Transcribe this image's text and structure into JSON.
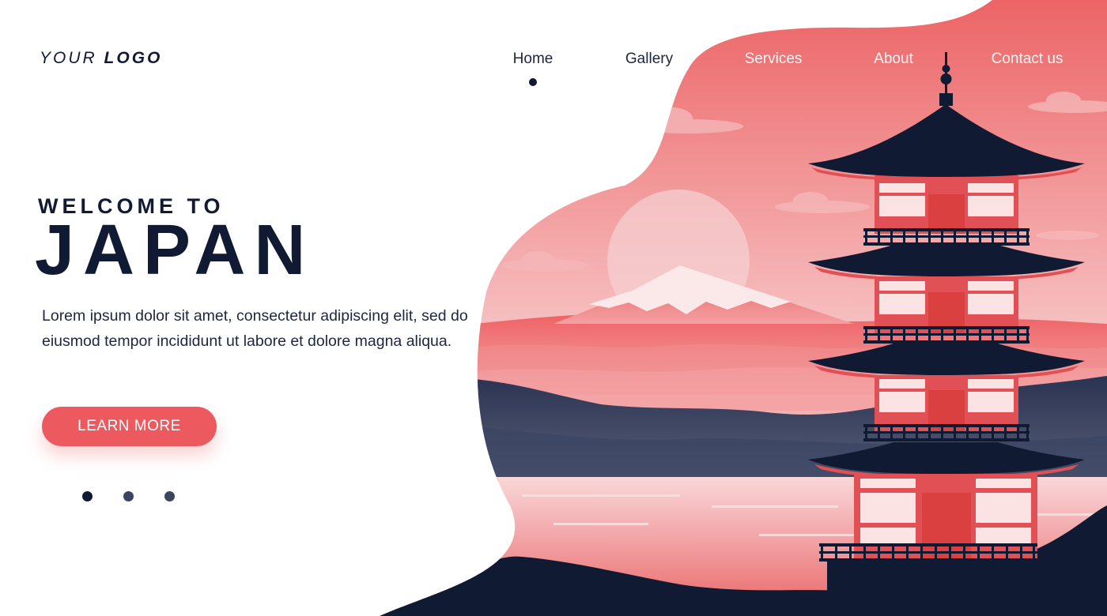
{
  "logo": {
    "part1": "YOUR",
    "part2": "LOGO"
  },
  "nav": {
    "items": [
      {
        "label": "Home",
        "active": true
      },
      {
        "label": "Gallery"
      },
      {
        "label": "Services"
      },
      {
        "label": "About"
      },
      {
        "label": "Contact us"
      }
    ]
  },
  "hero": {
    "eyebrow": "WELCOME TO",
    "title": "JAPAN",
    "description": "Lorem ipsum dolor sit amet, consectetur adipiscing elit, sed do eiusmod tempor incididunt ut labore et dolore magna aliqua.",
    "cta_label": "LEARN MORE"
  },
  "carousel": {
    "slide_count": 3,
    "active_index": 0
  },
  "illustration": {
    "subject": "pagoda-and-mount-fuji"
  },
  "colors": {
    "navy": "#101a33",
    "accent_red": "#ec5a5f",
    "sky_top": "#ec6466",
    "sky_bottom": "#f7c3c4",
    "pagoda_red": "#e05055",
    "pagoda_panel": "#fbe3e4"
  }
}
